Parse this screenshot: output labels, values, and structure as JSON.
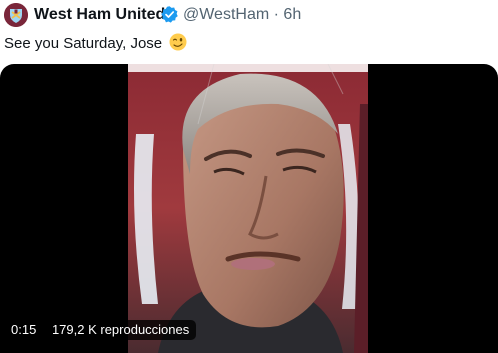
{
  "tweet": {
    "author_name": "West Ham United",
    "handle": "@WestHam",
    "separator": "·",
    "time": "6h",
    "text": "See you Saturday, Jose",
    "emoji_icon": "winking-face-icon",
    "verified_icon": "verified-badge-icon",
    "avatar_icon": "west-ham-crest-icon"
  },
  "video": {
    "elapsed": "0:15",
    "views": "179,2 K reproducciones"
  },
  "colors": {
    "text": "#0f1419",
    "muted": "#536471",
    "verified": "#1d9bf0",
    "claret": "#7a263a",
    "sky_blue": "#9ed6f4"
  }
}
